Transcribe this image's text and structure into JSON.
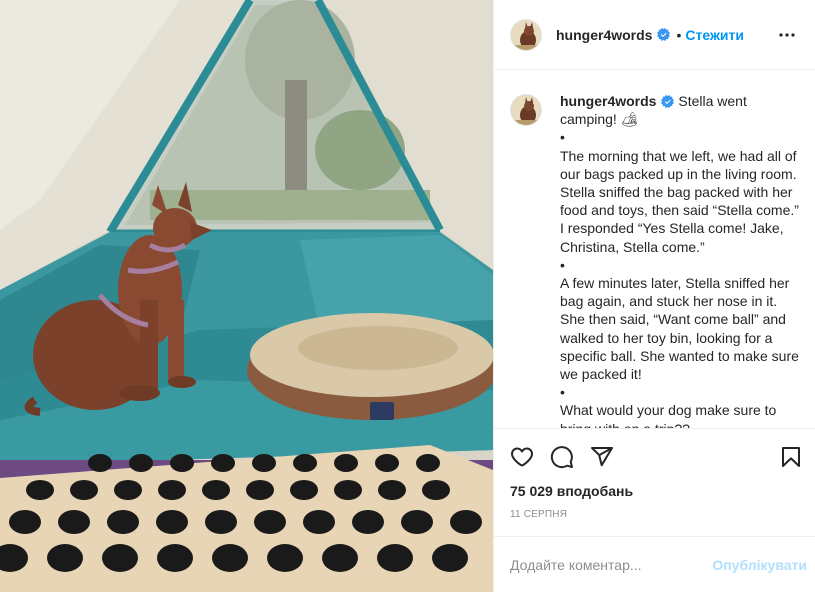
{
  "header": {
    "username": "hunger4words",
    "separator": "•",
    "follow_label": "Стежити",
    "more_icon": "more-horizontal-icon",
    "verified_icon": "verified-badge-icon"
  },
  "caption": {
    "username": "hunger4words",
    "text": "Stella went camping! 🏕\n•\nThe morning that we left, we had all of our bags packed up in the living room. Stella sniffed the bag packed with her food and toys, then said “Stella come.” I responded “Yes Stella come! Jake, Christina, Stella come.”\n•\nA few minutes later, Stella sniffed her bag again, and stuck her nose in it. She then said, “Want come ball” and walked to her toy bin, looking for a specific ball. She wanted to make sure we packed it!\n•\nWhat would your dog make sure to bring with on a trip??"
  },
  "actions": {
    "icons": [
      "heart-icon",
      "comment-icon",
      "share-icon",
      "bookmark-icon"
    ],
    "likes": "75 029 вподобань",
    "date": "11 СЕРПНЯ"
  },
  "comment_box": {
    "placeholder": "Додайте коментар...",
    "post_label": "Опублікувати"
  },
  "colors": {
    "accent": "#0095f6",
    "post_disabled": "#b2dffc",
    "verified": "#3897f0",
    "tent_teal": "#2b8c95",
    "tent_canvas": "#e9e6dc",
    "dog_brown": "#8a4a32",
    "bed_beige": "#d9c9a8",
    "board_wood": "#e8d5b5"
  }
}
